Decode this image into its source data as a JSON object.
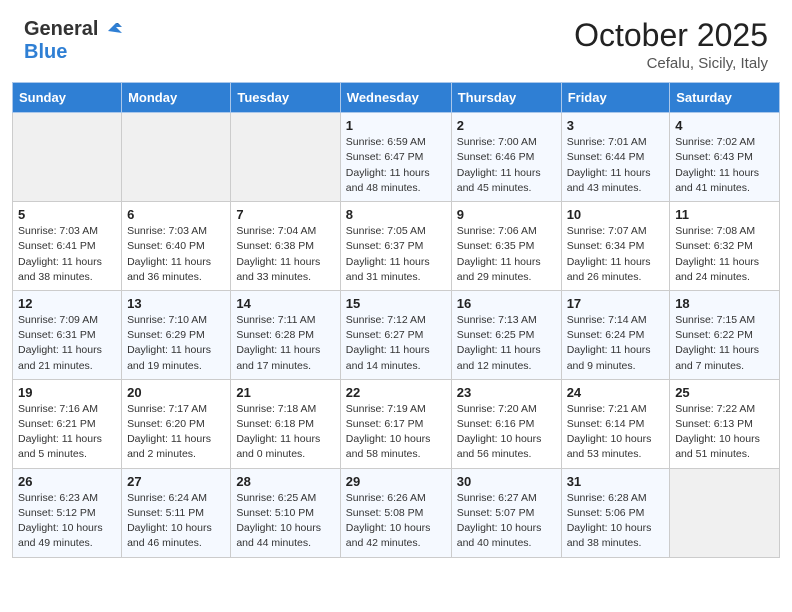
{
  "header": {
    "logo_general": "General",
    "logo_blue": "Blue",
    "month_title": "October 2025",
    "location": "Cefalu, Sicily, Italy"
  },
  "calendar": {
    "days_of_week": [
      "Sunday",
      "Monday",
      "Tuesday",
      "Wednesday",
      "Thursday",
      "Friday",
      "Saturday"
    ],
    "weeks": [
      [
        {
          "day": "",
          "info": ""
        },
        {
          "day": "",
          "info": ""
        },
        {
          "day": "",
          "info": ""
        },
        {
          "day": "1",
          "info": "Sunrise: 6:59 AM\nSunset: 6:47 PM\nDaylight: 11 hours\nand 48 minutes."
        },
        {
          "day": "2",
          "info": "Sunrise: 7:00 AM\nSunset: 6:46 PM\nDaylight: 11 hours\nand 45 minutes."
        },
        {
          "day": "3",
          "info": "Sunrise: 7:01 AM\nSunset: 6:44 PM\nDaylight: 11 hours\nand 43 minutes."
        },
        {
          "day": "4",
          "info": "Sunrise: 7:02 AM\nSunset: 6:43 PM\nDaylight: 11 hours\nand 41 minutes."
        }
      ],
      [
        {
          "day": "5",
          "info": "Sunrise: 7:03 AM\nSunset: 6:41 PM\nDaylight: 11 hours\nand 38 minutes."
        },
        {
          "day": "6",
          "info": "Sunrise: 7:03 AM\nSunset: 6:40 PM\nDaylight: 11 hours\nand 36 minutes."
        },
        {
          "day": "7",
          "info": "Sunrise: 7:04 AM\nSunset: 6:38 PM\nDaylight: 11 hours\nand 33 minutes."
        },
        {
          "day": "8",
          "info": "Sunrise: 7:05 AM\nSunset: 6:37 PM\nDaylight: 11 hours\nand 31 minutes."
        },
        {
          "day": "9",
          "info": "Sunrise: 7:06 AM\nSunset: 6:35 PM\nDaylight: 11 hours\nand 29 minutes."
        },
        {
          "day": "10",
          "info": "Sunrise: 7:07 AM\nSunset: 6:34 PM\nDaylight: 11 hours\nand 26 minutes."
        },
        {
          "day": "11",
          "info": "Sunrise: 7:08 AM\nSunset: 6:32 PM\nDaylight: 11 hours\nand 24 minutes."
        }
      ],
      [
        {
          "day": "12",
          "info": "Sunrise: 7:09 AM\nSunset: 6:31 PM\nDaylight: 11 hours\nand 21 minutes."
        },
        {
          "day": "13",
          "info": "Sunrise: 7:10 AM\nSunset: 6:29 PM\nDaylight: 11 hours\nand 19 minutes."
        },
        {
          "day": "14",
          "info": "Sunrise: 7:11 AM\nSunset: 6:28 PM\nDaylight: 11 hours\nand 17 minutes."
        },
        {
          "day": "15",
          "info": "Sunrise: 7:12 AM\nSunset: 6:27 PM\nDaylight: 11 hours\nand 14 minutes."
        },
        {
          "day": "16",
          "info": "Sunrise: 7:13 AM\nSunset: 6:25 PM\nDaylight: 11 hours\nand 12 minutes."
        },
        {
          "day": "17",
          "info": "Sunrise: 7:14 AM\nSunset: 6:24 PM\nDaylight: 11 hours\nand 9 minutes."
        },
        {
          "day": "18",
          "info": "Sunrise: 7:15 AM\nSunset: 6:22 PM\nDaylight: 11 hours\nand 7 minutes."
        }
      ],
      [
        {
          "day": "19",
          "info": "Sunrise: 7:16 AM\nSunset: 6:21 PM\nDaylight: 11 hours\nand 5 minutes."
        },
        {
          "day": "20",
          "info": "Sunrise: 7:17 AM\nSunset: 6:20 PM\nDaylight: 11 hours\nand 2 minutes."
        },
        {
          "day": "21",
          "info": "Sunrise: 7:18 AM\nSunset: 6:18 PM\nDaylight: 11 hours\nand 0 minutes."
        },
        {
          "day": "22",
          "info": "Sunrise: 7:19 AM\nSunset: 6:17 PM\nDaylight: 10 hours\nand 58 minutes."
        },
        {
          "day": "23",
          "info": "Sunrise: 7:20 AM\nSunset: 6:16 PM\nDaylight: 10 hours\nand 56 minutes."
        },
        {
          "day": "24",
          "info": "Sunrise: 7:21 AM\nSunset: 6:14 PM\nDaylight: 10 hours\nand 53 minutes."
        },
        {
          "day": "25",
          "info": "Sunrise: 7:22 AM\nSunset: 6:13 PM\nDaylight: 10 hours\nand 51 minutes."
        }
      ],
      [
        {
          "day": "26",
          "info": "Sunrise: 6:23 AM\nSunset: 5:12 PM\nDaylight: 10 hours\nand 49 minutes."
        },
        {
          "day": "27",
          "info": "Sunrise: 6:24 AM\nSunset: 5:11 PM\nDaylight: 10 hours\nand 46 minutes."
        },
        {
          "day": "28",
          "info": "Sunrise: 6:25 AM\nSunset: 5:10 PM\nDaylight: 10 hours\nand 44 minutes."
        },
        {
          "day": "29",
          "info": "Sunrise: 6:26 AM\nSunset: 5:08 PM\nDaylight: 10 hours\nand 42 minutes."
        },
        {
          "day": "30",
          "info": "Sunrise: 6:27 AM\nSunset: 5:07 PM\nDaylight: 10 hours\nand 40 minutes."
        },
        {
          "day": "31",
          "info": "Sunrise: 6:28 AM\nSunset: 5:06 PM\nDaylight: 10 hours\nand 38 minutes."
        },
        {
          "day": "",
          "info": ""
        }
      ]
    ]
  }
}
